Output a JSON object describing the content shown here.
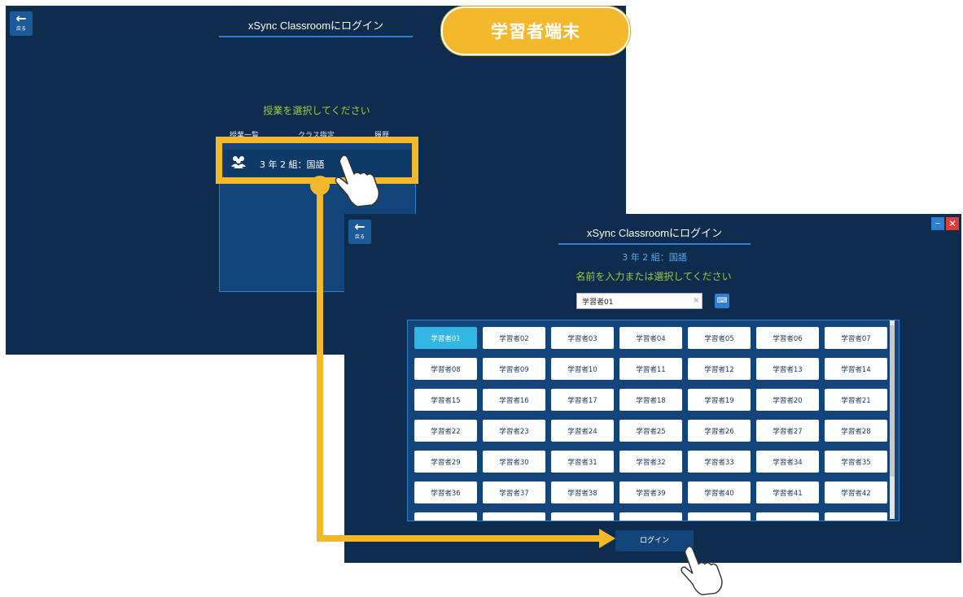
{
  "window1": {
    "back_label": "戻る",
    "title": "xSync Classroomにログイン",
    "prompt": "授業を選択してください",
    "tabs": [
      "授業一覧",
      "クラス指定",
      "履歴"
    ],
    "class_item": {
      "icon": "group-icon",
      "label": "3 年 2 組：国語"
    }
  },
  "badge": {
    "label": "学習者端末"
  },
  "window2": {
    "back_label": "戻る",
    "title": "xSync Classroomにログイン",
    "class_name": "3 年 2 組：国語",
    "prompt": "名前を入力または選択してください",
    "name_input": {
      "value": "学習者01"
    },
    "students": [
      "学習者01",
      "学習者02",
      "学習者03",
      "学習者04",
      "学習者05",
      "学習者06",
      "学習者07",
      "学習者08",
      "学習者09",
      "学習者10",
      "学習者11",
      "学習者12",
      "学習者13",
      "学習者14",
      "学習者15",
      "学習者16",
      "学習者17",
      "学習者18",
      "学習者19",
      "学習者20",
      "学習者21",
      "学習者22",
      "学習者23",
      "学習者24",
      "学習者25",
      "学習者26",
      "学習者27",
      "学習者28",
      "学習者29",
      "学習者30",
      "学習者31",
      "学習者32",
      "学習者33",
      "学習者34",
      "学習者35",
      "学習者36",
      "学習者37",
      "学習者38",
      "学習者39",
      "学習者40",
      "学習者41",
      "学習者42"
    ],
    "selected_student": "学習者01",
    "login_label": "ログイン"
  },
  "colors": {
    "window_bg": "#0e2c4d",
    "accent_yellow": "#f3b82b",
    "accent_blue": "#2f7fd1",
    "prompt_green": "#9ccb3a",
    "selected_cyan": "#34b6e4"
  }
}
